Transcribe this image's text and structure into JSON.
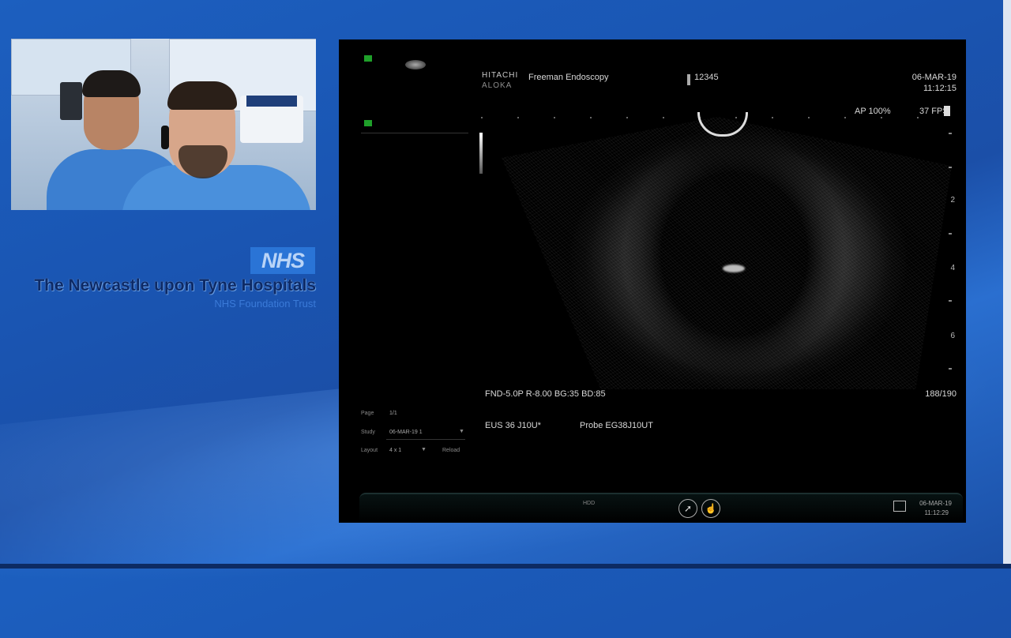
{
  "branding": {
    "logo": "NHS",
    "trust_name": "The Newcastle upon Tyne Hospitals",
    "trust_sub": "NHS Foundation Trust"
  },
  "ultrasound": {
    "brand_line1": "HITACHI",
    "brand_line2": "ALOKA",
    "facility": "Freeman Endoscopy",
    "patient_id": "12345",
    "date": "06-MAR-19",
    "time": "11:12:15",
    "ap": "AP 100%",
    "fps": "37 FPS",
    "params": "FND-5.0P    R-8.00 BG:35   BD:85",
    "frame": "188/190",
    "probe_mode": "EUS 36 J10U*",
    "probe_model": "Probe EG38J10UT",
    "depth_labels": [
      "2",
      "4",
      "6"
    ],
    "side_panel": {
      "page_label": "Page",
      "page_value": "1/1",
      "study_label": "Study",
      "study_value": "06-MAR-19  1",
      "layout_label": "Layout",
      "layout_value": "4 x 1",
      "reload": "Reload"
    },
    "footer": {
      "hdd": "HDD",
      "date": "06-MAR-19",
      "time": "11:12:29"
    }
  },
  "icons": [
    "pointer-icon",
    "touchpad-icon",
    "pc-icon",
    "patient-id-icon"
  ]
}
